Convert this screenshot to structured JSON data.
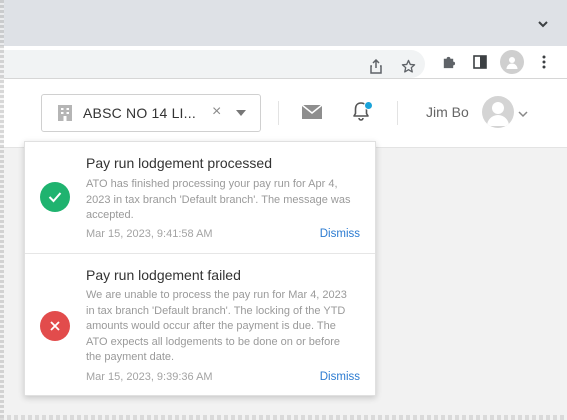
{
  "browser": {
    "tabstrip_chevron": "chevron-down-icon",
    "toolbar_icons": [
      "share-icon",
      "star-icon",
      "extensions-icon",
      "side-panel-icon",
      "profile-icon",
      "kebab-menu-icon"
    ]
  },
  "header": {
    "branch_select": {
      "value": "ABSC NO 14 LI...",
      "clear_glyph": "×"
    },
    "notifications": {
      "has_unread": true
    },
    "user": {
      "name": "Jim Bo"
    }
  },
  "notifications": [
    {
      "status": "success",
      "title": "Pay run lodgement processed",
      "body": "ATO has finished processing your pay run for Apr 4, 2023 in tax branch 'Default branch'. The message was accepted.",
      "timestamp": "Mar 15, 2023, 9:41:58 AM",
      "action": "Dismiss"
    },
    {
      "status": "error",
      "title": "Pay run lodgement failed",
      "body": "We are unable to process the pay run for Mar 4, 2023 in tax branch 'Default branch'. The locking of the YTD amounts would occur after the payment is due. The ATO expects all lodgements to be done on or before the payment date.",
      "timestamp": "Mar 15, 2023, 9:39:36 AM",
      "action": "Dismiss"
    }
  ],
  "colors": {
    "success": "#1fb36f",
    "error": "#e24c4c",
    "link": "#2b7bd1",
    "unread_dot": "#1aa3d9"
  }
}
